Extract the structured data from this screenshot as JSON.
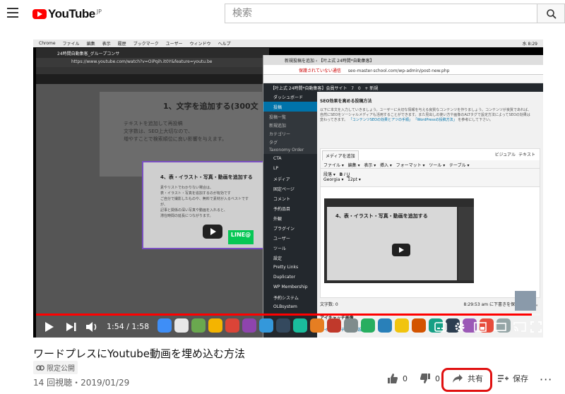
{
  "header": {
    "brand": "YouTube",
    "region": "JP",
    "search_placeholder": "検索"
  },
  "player": {
    "mac_menu": [
      "Chrome",
      "ファイル",
      "編集",
      "表示",
      "履歴",
      "ブックマーク",
      "ユーザー",
      "ウィンドウ",
      "ヘルプ"
    ],
    "mac_clock": "水 8:29",
    "left_window": {
      "tab": "24時間自動集客_グループコンサ",
      "url": "https://www.youtube.com/watch?v=OiPqih.it0Y&feature=youtu.be",
      "slide_title": "1、文字を追加する(300文",
      "slide_body": [
        "テキストを追加して再投稿",
        "文字数は、SEO上大切なので、",
        "増やすことで検索順位に良い影響を与えます。"
      ],
      "popup_title": "4、表・イラスト・写真・動画を追加する",
      "popup_lines": [
        "素やリストでわかりない場合は、",
        "表・イラスト・写真を追加するのが有効です",
        "ご自分で撮影したものや、無料で素材が入るベストですが、",
        "記事と関係の深い写真や動画を入れると、",
        "滞在時間の延長につながります。"
      ],
      "line_label": "LINE@"
    },
    "right_window": {
      "tab": "新規投稿を追加 ‹ 【叶上式 24時間*自動集客】",
      "url_warning": "保護されていない通信",
      "url": "seo-master-school.com/wp-admin/post-new.php",
      "admin_bar": [
        "【叶上式 24時間*自動集客】会員サイト",
        "7",
        "0",
        "+ 新規"
      ],
      "sidebar": [
        {
          "label": "ダッシュボード",
          "type": "item"
        },
        {
          "label": "投稿",
          "type": "active"
        },
        {
          "label": "投稿一覧",
          "type": "sub"
        },
        {
          "label": "新規追加",
          "type": "sub"
        },
        {
          "label": "カテゴリー",
          "type": "sub"
        },
        {
          "label": "タグ",
          "type": "sub"
        },
        {
          "label": "Taxonomy Order",
          "type": "sub"
        },
        {
          "label": "CTA",
          "type": "item"
        },
        {
          "label": "LP",
          "type": "item"
        },
        {
          "label": "メディア",
          "type": "item"
        },
        {
          "label": "固定ページ",
          "type": "item"
        },
        {
          "label": "コメント",
          "type": "item"
        },
        {
          "label": "予約品目",
          "type": "item"
        },
        {
          "label": "外観",
          "type": "item"
        },
        {
          "label": "プラグイン",
          "type": "item"
        },
        {
          "label": "ユーザー",
          "type": "item"
        },
        {
          "label": "ツール",
          "type": "item"
        },
        {
          "label": "設定",
          "type": "item"
        },
        {
          "label": "Pretty Links",
          "type": "item"
        },
        {
          "label": "Duplicator",
          "type": "item"
        },
        {
          "label": "WP Membership",
          "type": "item"
        },
        {
          "label": "予約システム",
          "type": "item"
        },
        {
          "label": "OLBsystem",
          "type": "item"
        }
      ],
      "post_heading": "SEO効果を高める投稿方法",
      "post_text": "以下に本文を入力していきましょう。ユーザーに大切な情報を与える良質なコンテンツを作りましょう。コンテンツが良質であれば、自然にSEOをソーシャルメディアも活用することができます。また見出しの使い方や画像のALTタグで設定方法によってSEOの効果は変わってきます。",
      "post_link": "「コンテンツSEOの効果とアツの手順」",
      "post_link2": "「WordPressの投稿方法」",
      "post_link_suffix": "を参考にして下さい。",
      "add_media": "メディアを追加",
      "tab_visual": "ビジュアル",
      "tab_text": "テキスト",
      "editor_menu": [
        "ファイル",
        "編集",
        "表示",
        "挿入",
        "フォーマット",
        "ツール",
        "テーブル"
      ],
      "format_select": "段落",
      "font_select": "Georgia",
      "size_select": "12pt",
      "embed_title": "4、表・イラスト・写真・動画を追加する",
      "word_count": "文字数: 0",
      "autosave": "8:29:53 am に下書きを保存しました。",
      "eyecatch_heading": "アイキャッチ画像",
      "eyecatch_link": "アイキャッチ画像を設定"
    },
    "progress_fraction": 0.983,
    "time_display": "1:54 / 1:58"
  },
  "video": {
    "title": "ワードプレスにYoutube動画を埋め込む方法",
    "privacy": "限定公開",
    "meta": "14 回視聴・2019/01/29",
    "likes": "0",
    "dislikes": "0",
    "share_label": "共有",
    "save_label": "保存"
  }
}
